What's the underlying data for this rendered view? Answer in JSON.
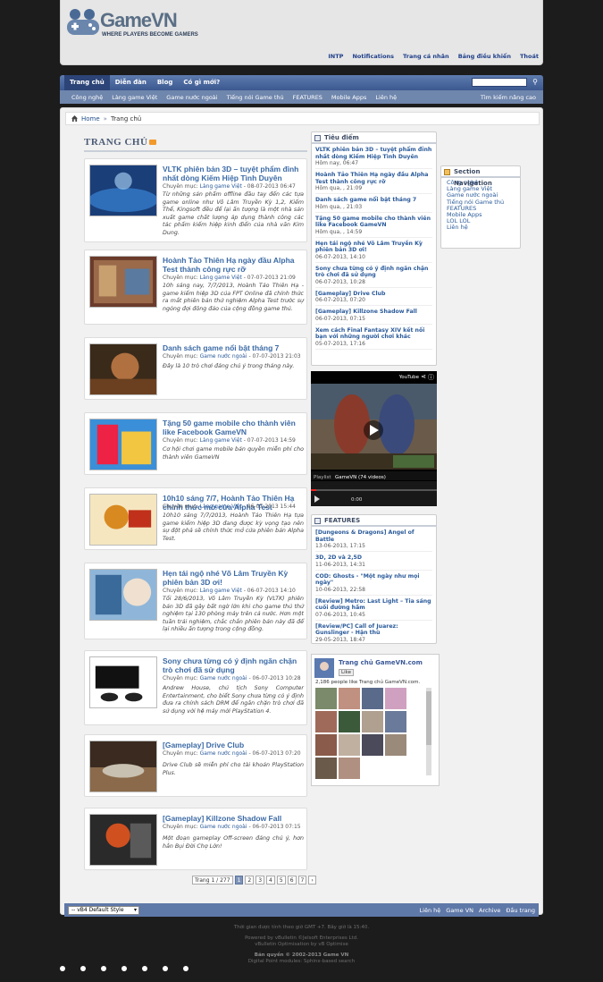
{
  "site": {
    "name": "GameVN",
    "tagline": "WHERE PLAYERS BECOME GAMERS"
  },
  "toplinks": [
    "INTP",
    "Notifications",
    "Trang cá nhân",
    "Bảng điều khiển",
    "Thoát"
  ],
  "nav": {
    "main": [
      "Trang chủ",
      "Diễn đàn",
      "Blog",
      "Có gì mới?"
    ],
    "sub": [
      "Công nghệ",
      "Làng game Việt",
      "Game nước ngoài",
      "Tiếng nói Game thủ",
      "FEATURES",
      "Mobile Apps",
      "Liên hệ"
    ],
    "right": "Tìm kiếm nâng cao"
  },
  "breadcrumb": {
    "home": "Home",
    "current": "Trang chủ"
  },
  "feed_title": "TRANG CHỦ",
  "articles": [
    {
      "title": "VLTK phiên bản 3D – tuyệt phẩm đỉnh nhất dòng Kiếm Hiệp Tình Duyên",
      "cat": "Làng game Việt",
      "date": "08-07-2013 06:47",
      "desc": "Từ những sản phẩm offline đầu tay đến các tựa game online như Võ Lâm Truyền Kỳ 1,2, Kiếm Thế, Kingsoft đều để lại ấn tượng là một nhà sản xuất game chất lượng áp dụng thành công các tác phẩm kiếm hiệp kinh điển của nhà văn Kim Dung."
    },
    {
      "title": "Hoành Tảo Thiên Hạ ngày đầu Alpha Test thành công rực rỡ",
      "cat": "Làng game Việt",
      "date": "07-07-2013 21:09",
      "desc": "10h sáng nay, 7/7/2013, Hoành Tảo Thiên Hạ - game kiếm hiệp 3D của FPT Online đã chính thức ra mắt phiên bản thử nghiệm Alpha Test trước sự ngóng đợi đông đảo của cộng đồng game thủ."
    },
    {
      "title": "Danh sách game nổi bật tháng 7",
      "cat": "Game nước ngoài",
      "date": "07-07-2013 21:03",
      "desc": "Đây là 10 trò chơi đáng chú ý trong tháng này."
    },
    {
      "title": "Tặng 50 game mobile cho thành viên like Facebook GameVN",
      "cat": "Làng game Việt",
      "date": "07-07-2013 14:59",
      "desc": "Cơ hội chơi game mobile bản quyền miễn phí cho thành viên GameVN"
    },
    {
      "title": "10h10 sáng 7/7, Hoành Tảo Thiên Hạ chính thức mở cửa Alpha Test",
      "cat": "Làng game Việt",
      "date": "06-07-2013 15:44",
      "desc": "10h10 sáng 7/7/2013, Hoành Tảo Thiên Hạ tựa game kiếm hiệp 3D đang được kỳ vọng tạo nên sự đột phá sẽ chính thức mở cửa phiên bản Alpha Test."
    },
    {
      "title": "Hẹn tái ngộ nhé Võ Lâm Truyền Kỳ phiên bản 3D ơi!",
      "cat": "Làng game Việt",
      "date": "06-07-2013 14:10",
      "desc": "Tối 28/6/2013, Võ Lâm Truyền Kỳ (VLTK) phiên bản 3D đã gây bất ngờ lớn khi cho game thủ thử nghiệm tại 130 phòng máy trên cả nước. Hơn một tuần trải nghiệm, chắc chắn phiên bản này đã để lại nhiều ấn tượng trong cộng đồng."
    },
    {
      "title": "Sony chưa từng có ý định ngăn chặn trò chơi đã sử dụng",
      "cat": "Game nước ngoài",
      "date": "06-07-2013 10:28",
      "desc": "Andrew House, chủ tịch Sony Computer Entertainment, cho biết Sony chưa từng có ý định đưa ra chính sách DRM để ngăn chặn trò chơi đã sử dụng với hệ máy mới PlayStation 4."
    },
    {
      "title": "[Gameplay] Drive Club",
      "cat": "Game nước ngoài",
      "date": "06-07-2013 07:20",
      "desc": "Drive Club sẽ miễn phí cho tài khoản PlayStation Plus."
    },
    {
      "title": "[Gameplay] Killzone Shadow Fall",
      "cat": "Game nước ngoài",
      "date": "06-07-2013 07:15",
      "desc": "Một đoạn gameplay Off-screen đáng chú ý, hơn hẳn Bụi Đời Chợ Lớn!"
    }
  ],
  "meta_prefix": "Chuyên mục:",
  "pager": {
    "label": "Trang 1 / 277",
    "pages": [
      "1",
      "2",
      "3",
      "4",
      "5",
      "6",
      "7"
    ],
    "current": "1",
    "next": "›"
  },
  "tieu_diem": {
    "title": "Tiêu điểm",
    "items": [
      {
        "t": "VLTK phiên bản 3D – tuyệt phẩm đỉnh nhất dòng Kiếm Hiệp Tình Duyên",
        "d": "Hôm nay, 06:47"
      },
      {
        "t": "Hoành Tảo Thiên Hạ ngày đầu Alpha Test thành công rực rỡ",
        "d": "Hôm qua, , 21:09"
      },
      {
        "t": "Danh sách game nổi bật tháng 7",
        "d": "Hôm qua, , 21:03"
      },
      {
        "t": "Tặng 50 game mobile cho thành viên like Facebook GameVN",
        "d": "Hôm qua, , 14:59"
      },
      {
        "t": "Hẹn tái ngộ nhé Võ Lâm Truyền Kỳ phiên bản 3D ơi!",
        "d": "06-07-2013, 14:10"
      },
      {
        "t": "Sony chưa từng có ý định ngăn chặn trò chơi đã sử dụng",
        "d": "06-07-2013, 10:28"
      },
      {
        "t": "[Gameplay] Drive Club",
        "d": "06-07-2013, 07:20"
      },
      {
        "t": "[Gameplay] Killzone Shadow Fall",
        "d": "06-07-2013, 07:15"
      },
      {
        "t": "Xem cách Final Fantasy XIV kết nối bạn với những người chơi khác",
        "d": "05-07-2013, 17:16"
      }
    ]
  },
  "youtube": {
    "brand": "YouTube",
    "playlist": "Playlist",
    "channel": "GameVN (74 videos)",
    "time": "0:00"
  },
  "features": {
    "title": "FEATURES",
    "items": [
      {
        "t": "[Dungeons & Dragons] Angel of Battle",
        "d": "13-06-2013, 17:15"
      },
      {
        "t": "3D, 2D và 2,5D",
        "d": "11-06-2013, 14:31"
      },
      {
        "t": "COD: Ghosts - \"Một ngày như mọi ngày\"",
        "d": "10-06-2013, 22:58"
      },
      {
        "t": "[Review] Metro: Last Light – Tia sáng cuối đường hầm",
        "d": "07-06-2013, 10:45"
      },
      {
        "t": "[Review/PC] Call of Juarez: Gunslinger - Hận thù",
        "d": "29-05-2013, 18:47"
      }
    ]
  },
  "section_nav": {
    "title": "Section Navigation",
    "items": [
      "Công nghệ",
      "Làng game Việt",
      "Game nước ngoài",
      "Tiếng nói Game thủ",
      "FEATURES",
      "Mobile Apps",
      "LOL LOL",
      "Liên hệ"
    ]
  },
  "facebook": {
    "page": "Trang chủ GameVN.com",
    "like": "Like",
    "count": "2,186 people like Trang chủ GameVN.com."
  },
  "footer": {
    "style": "-- vB4 Default Style",
    "links": [
      "Liên hệ",
      "Game VN",
      "Archive",
      "Đầu trang"
    ],
    "lines": [
      "Thời gian được tính theo giờ GMT +7. Bây giờ là 15:40.",
      "Powered by vBulletin ©Jelsoft Enterprises Ltd.",
      "vBulletin Optimisation by vB Optimise",
      "Bản quyền © 2002-2013 Game VN",
      "Digital Point modules: Sphinx-based search"
    ]
  },
  "colors": {
    "nav": "#3c5890",
    "link": "#1f4f8a",
    "accent": "#f19a2b"
  }
}
